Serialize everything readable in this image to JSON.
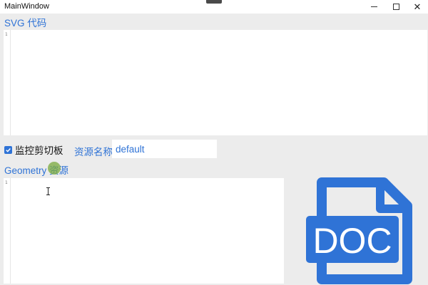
{
  "window": {
    "title": "MainWindow",
    "minimize_icon": "minimize-icon",
    "maximize_icon": "maximize-icon",
    "close_icon": "close-icon",
    "close_glyph": "✕"
  },
  "svg_section": {
    "heading": "SVG 代码",
    "line_numbers": [
      "1"
    ],
    "content": ""
  },
  "toolbar": {
    "monitor_clipboard_label": "监控剪切板",
    "monitor_clipboard_checked": true,
    "resource_name_label": "资源名称",
    "resource_name_value": "default"
  },
  "geometry_section": {
    "heading": "Geometry 资源",
    "line_numbers": [
      "1"
    ],
    "content": ""
  },
  "preview": {
    "icon": "doc-file-icon",
    "text": "DOC",
    "color": "#2f73d6"
  },
  "colors": {
    "accent": "#2f73d6",
    "background": "#ececec"
  }
}
